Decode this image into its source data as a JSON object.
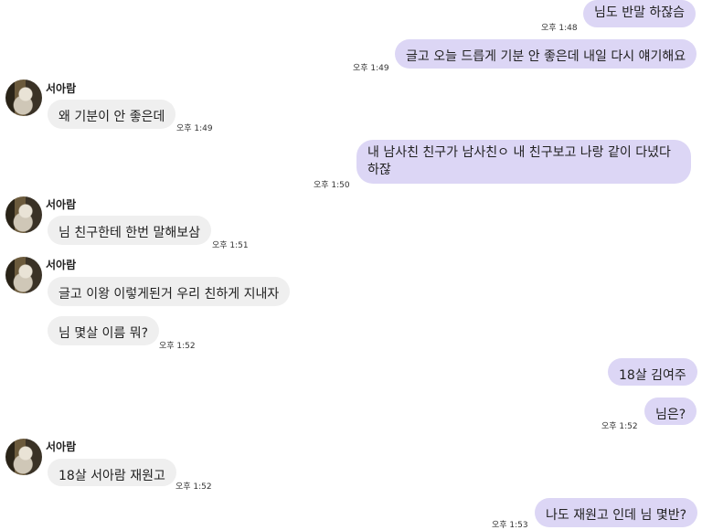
{
  "contact": {
    "name": "서아람"
  },
  "messages": [
    {
      "dir": "out",
      "text": "님도 반말 하잖슴",
      "time": "오후 1:48"
    },
    {
      "dir": "out",
      "text": "글고 오늘 드릅게 기분 안 좋은데 내일 다시 얘기해요",
      "time": "오후 1:49"
    },
    {
      "dir": "in",
      "text": "왜 기분이 안 좋은데",
      "time": "오후 1:49"
    },
    {
      "dir": "out",
      "text": "내 남사친 친구가 남사친ㅇ 내 친구보고 나랑 같이 다녔다 하잖",
      "time": "오후 1:50"
    },
    {
      "dir": "in",
      "text": "님 친구한테 한번 말해보삼",
      "time": "오후 1:51"
    },
    {
      "dir": "in",
      "text": "글고 이왕 이렇게된거 우리 친하게 지내자",
      "time": ""
    },
    {
      "dir": "in",
      "text": "님 몇살 이름 뭐?",
      "time": "오후 1:52"
    },
    {
      "dir": "out",
      "text": "18살 김여주",
      "time": ""
    },
    {
      "dir": "out",
      "text": "님은?",
      "time": "오후 1:52"
    },
    {
      "dir": "in",
      "text": "18살 서아람 재원고",
      "time": "오후 1:52"
    },
    {
      "dir": "out",
      "text": "나도 재원고 인데 님 몇반?",
      "time": "오후 1:53"
    }
  ]
}
